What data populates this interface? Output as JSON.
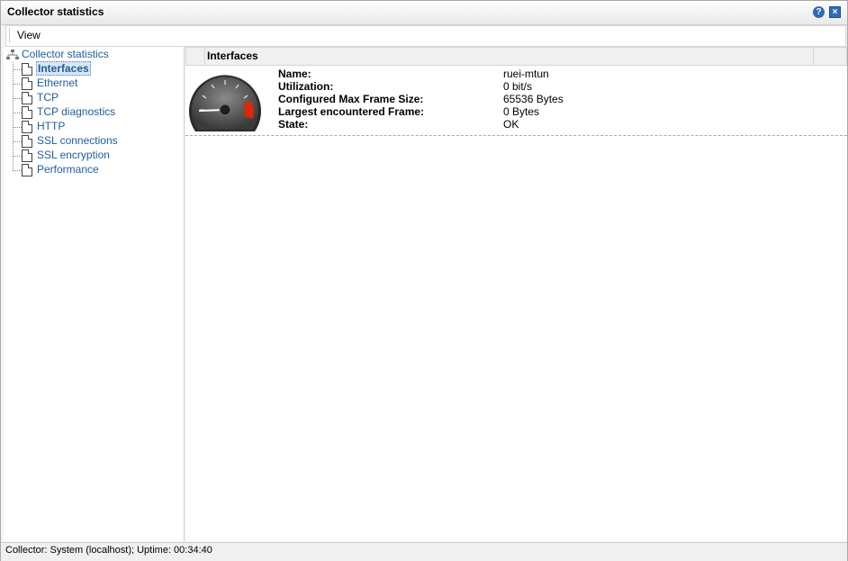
{
  "window": {
    "title": "Collector statistics"
  },
  "menu": {
    "view_label": "View"
  },
  "tree": {
    "root_label": "Collector statistics",
    "items": [
      {
        "label": "Interfaces",
        "selected": true
      },
      {
        "label": "Ethernet"
      },
      {
        "label": "TCP"
      },
      {
        "label": "TCP diagnostics"
      },
      {
        "label": "HTTP"
      },
      {
        "label": "SSL connections"
      },
      {
        "label": "SSL encryption"
      },
      {
        "label": "Performance"
      }
    ]
  },
  "panel": {
    "header": "Interfaces",
    "properties": [
      {
        "label": "Name:",
        "value": "ruei-mtun"
      },
      {
        "label": "Utilization:",
        "value": "0 bit/s"
      },
      {
        "label": "Configured Max Frame Size:",
        "value": "65536 Bytes"
      },
      {
        "label": "Largest encountered Frame:",
        "value": "0 Bytes"
      },
      {
        "label": "State:",
        "value": "OK"
      }
    ]
  },
  "status": {
    "text": "Collector: System (localhost); Uptime: 00:34:40"
  },
  "icons": {
    "help": "help-icon",
    "close": "close-icon",
    "gauge": "speedometer-gauge-icon",
    "root": "network-tree-icon",
    "doc": "document-icon"
  },
  "colors": {
    "link": "#1f5d99",
    "accent": "#2f6db5",
    "gauge_redline": "#d8290b"
  }
}
